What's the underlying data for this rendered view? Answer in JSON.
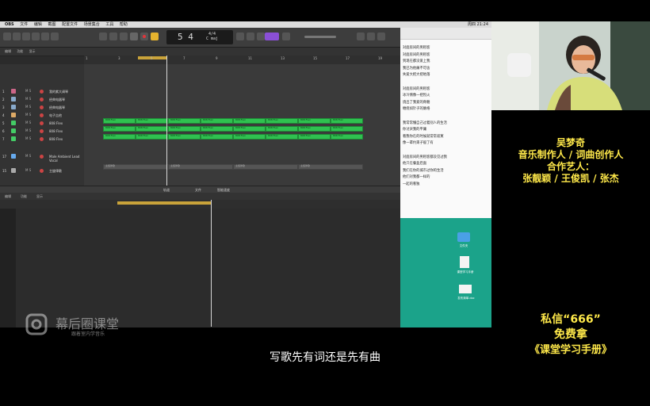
{
  "menubar": {
    "items": [
      "OBS",
      "文件",
      "编辑",
      "截图",
      "配置文件",
      "场景集合",
      "工具",
      "帮助"
    ],
    "right": "周四 21:24"
  },
  "daw": {
    "lcd": {
      "bar": "5 4",
      "tempo": "",
      "sig_top": "4/4",
      "sig_bottom": "C maj"
    },
    "ruler_marks": [
      "1",
      "3",
      "5",
      "7",
      "9",
      "11",
      "13",
      "15",
      "17",
      "19"
    ],
    "header_labels": [
      "编辑",
      "功能",
      "显示"
    ],
    "tracks": [
      {
        "num": "1",
        "name": "我的紫大调琴"
      },
      {
        "num": "2",
        "name": "经典电器琴"
      },
      {
        "num": "3",
        "name": "经典电器琴"
      },
      {
        "num": "4",
        "name": "电子吉他"
      },
      {
        "num": "5",
        "name": "808 Flex"
      },
      {
        "num": "6",
        "name": "808 Flex"
      },
      {
        "num": "7",
        "name": "808 Flex"
      },
      {
        "num": "17",
        "name": "Male Ambient Lead Vocal"
      },
      {
        "num": "15",
        "name": "主旋律歌"
      }
    ],
    "region_label": "808 Flex",
    "audio_region_label": "主旋律歌",
    "editor_tabs": [
      "轨道",
      "文件",
      "智能速度"
    ],
    "editor_menu": [
      "编辑",
      "功能",
      "显示"
    ]
  },
  "notes": {
    "lyrics": [
      "对面房间的男租客",
      "对面房间的男租客",
      "到现在都没爱上我",
      "我已为他痛不可舍",
      "失爱大把大把地落",
      "",
      "对面房间的男租客",
      "冰冷情像一把烈火",
      "烧出了我爱的骨骼",
      "缠绕如针子的脉络",
      "",
      "我常常懂自己过着别人的生活",
      "你讨厌我的平庸",
      "看我你在的时候就常常寂寞",
      "像一辈约束子般了有",
      "",
      "对面房间的男租客都没见过我",
      "他只在餐盒后面",
      "我们在你的城市过你的生活",
      "他们对我都一样的",
      "一起的看独"
    ]
  },
  "desktop": {
    "icons": [
      "",
      "文件夹",
      "课堂学习手册",
      "发布清单.doc"
    ]
  },
  "right_panel": {
    "name": "吴梦奇",
    "role": "音乐制作人 / 词曲创作人",
    "collab_label": "合作艺人：",
    "collab_names": "张靓颖 / 王俊凯 / 张杰",
    "promo_line1": "私信“666”",
    "promo_line2": "免费拿",
    "promo_line3": "《课堂学习手册》"
  },
  "watermark": {
    "brand": "幕后圈课堂",
    "slogan": "跟着室内学音乐"
  },
  "subtitle": "写歌先有词还是先有曲"
}
